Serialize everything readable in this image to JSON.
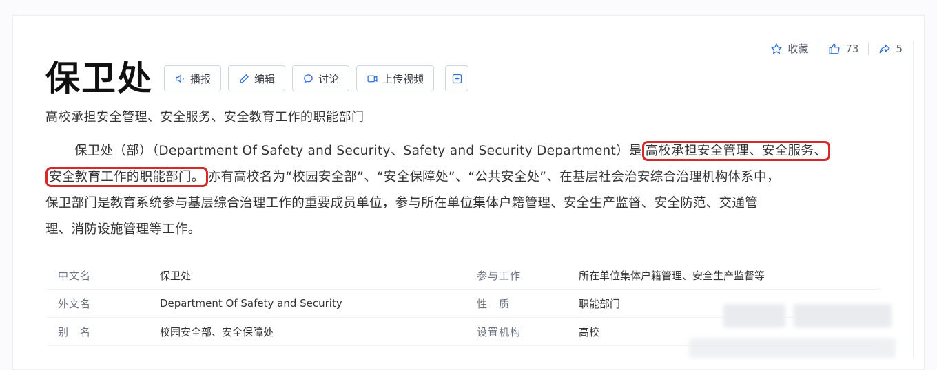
{
  "actions": {
    "favorite_label": "收藏",
    "like_count": "73",
    "share_count": "5"
  },
  "title": "保卫处",
  "toolbar": {
    "report_label": "播报",
    "edit_label": "编辑",
    "discuss_label": "讨论",
    "upload_video_label": "上传视频",
    "add_label": "+"
  },
  "subtitle": "高校承担安全管理、安全服务、安全教育工作的职能部门",
  "paragraph": {
    "l1_a": "保卫处（部）（Department Of Safety and Security、Safety and Security Department）是",
    "l1_hl": "高校承担安全管理、安全服务、",
    "l2_hl": "安全教育工作的职能部门。",
    "l2_b": "亦有高校名为“校园安全部”、“安全保障处”、“公共安全处”、在基层社会治安综合治理机构体系中，",
    "l3": "保卫部门是教育系统参与基层综合治理工作的重要成员单位，参与所在单位集体户籍管理、安全生产监督、安全防范、交通管",
    "l4": "理、消防设施管理等工作。"
  },
  "info": [
    {
      "label": "中文名",
      "value": "保卫处",
      "label2": "参与工作",
      "value2": "所在单位集体户籍管理、安全生产监督等"
    },
    {
      "label": "外文名",
      "value": "Department Of Safety and Security",
      "label2": "性　质",
      "value2": "职能部门"
    },
    {
      "label": "别　名",
      "value": "校园安全部、安全保障处",
      "label2": "设置机构",
      "value2": "高校"
    }
  ],
  "colors": {
    "highlight": "#d42a2a",
    "accent": "#2f6fd6"
  }
}
